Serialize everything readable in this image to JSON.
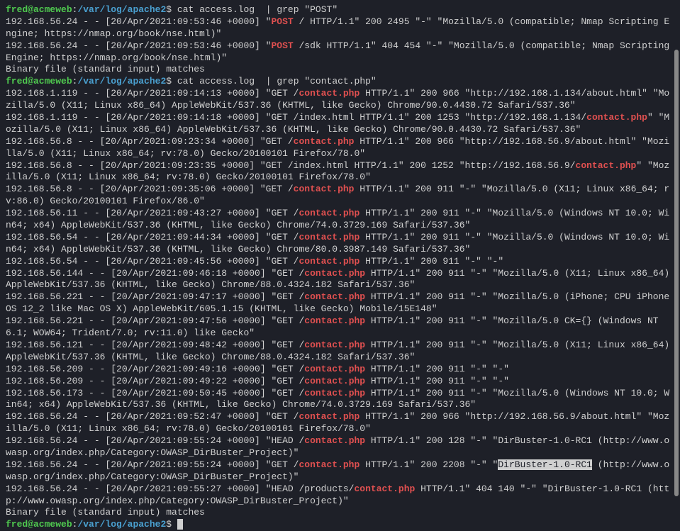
{
  "prompt": {
    "user": "fred@acmeweb",
    "colon": ":",
    "path": "/var/log/apache2",
    "dollar": "$"
  },
  "cmd1": "cat access.log  | grep \"POST\"",
  "cmd2": "cat access.log  | grep \"contact.php\"",
  "lines": {
    "l1a": "192.168.56.24 - - [20/Apr/2021:09:53:46 +0000] \"",
    "l1b": " / HTTP/1.1\" 200 2495 \"-\" \"Mozilla/5.0 (compatible; Nmap Scripting Engine; https://nmap.org/book/nse.html)\"",
    "l2a": "192.168.56.24 - - [20/Apr/2021:09:53:46 +0000] \"",
    "l2b": " /sdk HTTP/1.1\" 404 454 \"-\" \"Mozilla/5.0 (compatible; Nmap Scripting Engine; https://nmap.org/book/nse.html)\"",
    "l3": "Binary file (standard input) matches",
    "c1a": "192.168.1.119 - - [20/Apr/2021:09:14:13 +0000] \"GET /",
    "c1b": " HTTP/1.1\" 200 966 \"http://192.168.1.134/about.html\" \"Mozilla/5.0 (X11; Linux x86_64) AppleWebKit/537.36 (KHTML, like Gecko) Chrome/90.0.4430.72 Safari/537.36\"",
    "c2a": "192.168.1.119 - - [20/Apr/2021:09:14:18 +0000] \"GET /index.html HTTP/1.1\" 200 1253 \"http://192.168.1.134/",
    "c2b": "\" \"Mozilla/5.0 (X11; Linux x86_64) AppleWebKit/537.36 (KHTML, like Gecko) Chrome/90.0.4430.72 Safari/537.36\"",
    "c3a": "192.168.56.8 - - [20/Apr/2021:09:23:34 +0000] \"GET /",
    "c3b": " HTTP/1.1\" 200 966 \"http://192.168.56.9/about.html\" \"Mozilla/5.0 (X11; Linux x86_64; rv:78.0) Gecko/20100101 Firefox/78.0\"",
    "c4a": "192.168.56.8 - - [20/Apr/2021:09:23:35 +0000] \"GET /index.html HTTP/1.1\" 200 1252 \"http://192.168.56.9/",
    "c4b": "\" \"Mozilla/5.0 (X11; Linux x86_64; rv:78.0) Gecko/20100101 Firefox/78.0\"",
    "c5a": "192.168.56.8 - - [20/Apr/2021:09:35:06 +0000] \"GET /",
    "c5b": " HTTP/1.1\" 200 911 \"-\" \"Mozilla/5.0 (X11; Linux x86_64; rv:86.0) Gecko/20100101 Firefox/86.0\"",
    "c6a": "192.168.56.11 - - [20/Apr/2021:09:43:27 +0000] \"GET /",
    "c6b": " HTTP/1.1\" 200 911 \"-\" \"Mozilla/5.0 (Windows NT 10.0; Win64; x64) AppleWebKit/537.36 (KHTML, like Gecko) Chrome/74.0.3729.169 Safari/537.36\"",
    "c7a": "192.168.56.54 - - [20/Apr/2021:09:44:34 +0000] \"GET /",
    "c7b": " HTTP/1.1\" 200 911 \"-\" \"Mozilla/5.0 (Windows NT 10.0; Win64; x64) AppleWebKit/537.36 (KHTML, like Gecko) Chrome/80.0.3987.149 Safari/537.36\"",
    "c8a": "192.168.56.54 - - [20/Apr/2021:09:45:56 +0000] \"GET /",
    "c8b": " HTTP/1.1\" 200 911 \"-\" \"-\"",
    "c9a": "192.168.56.144 - - [20/Apr/2021:09:46:18 +0000] \"GET /",
    "c9b": " HTTP/1.1\" 200 911 \"-\" \"Mozilla/5.0 (X11; Linux x86_64) AppleWebKit/537.36 (KHTML, like Gecko) Chrome/88.0.4324.182 Safari/537.36\"",
    "c10a": "192.168.56.221 - - [20/Apr/2021:09:47:17 +0000] \"GET /",
    "c10b": " HTTP/1.1\" 200 911 \"-\" \"Mozilla/5.0 (iPhone; CPU iPhone OS 12_2 like Mac OS X) AppleWebKit/605.1.15 (KHTML, like Gecko) Mobile/15E148\"",
    "c11a": "192.168.56.221 - - [20/Apr/2021:09:47:56 +0000] \"GET /",
    "c11b": " HTTP/1.1\" 200 911 \"-\" \"Mozilla/5.0 CK={} (Windows NT 6.1; WOW64; Trident/7.0; rv:11.0) like Gecko\"",
    "c12a": "192.168.56.121 - - [20/Apr/2021:09:48:42 +0000] \"GET /",
    "c12b": " HTTP/1.1\" 200 911 \"-\" \"Mozilla/5.0 (X11; Linux x86_64) AppleWebKit/537.36 (KHTML, like Gecko) Chrome/88.0.4324.182 Safari/537.36\"",
    "c13a": "192.168.56.209 - - [20/Apr/2021:09:49:16 +0000] \"GET /",
    "c13b": " HTTP/1.1\" 200 911 \"-\" \"-\"",
    "c14a": "192.168.56.209 - - [20/Apr/2021:09:49:22 +0000] \"GET /",
    "c14b": " HTTP/1.1\" 200 911 \"-\" \"-\"",
    "c15a": "192.168.56.173 - - [20/Apr/2021:09:50:45 +0000] \"GET /",
    "c15b": " HTTP/1.1\" 200 911 \"-\" \"Mozilla/5.0 (Windows NT 10.0; Win64; x64) AppleWebKit/537.36 (KHTML, like Gecko) Chrome/74.0.3729.169 Safari/537.36\"",
    "c16a": "192.168.56.24 - - [20/Apr/2021:09:52:47 +0000] \"GET /",
    "c16b": " HTTP/1.1\" 200 966 \"http://192.168.56.9/about.html\" \"Mozilla/5.0 (X11; Linux x86_64; rv:78.0) Gecko/20100101 Firefox/78.0\"",
    "c17a": "192.168.56.24 - - [20/Apr/2021:09:55:24 +0000] \"HEAD /",
    "c17b": " HTTP/1.1\" 200 128 \"-\" \"DirBuster-1.0-RC1 (http://www.owasp.org/index.php/Category:OWASP_DirBuster_Project)\"",
    "c18a": "192.168.56.24 - - [20/Apr/2021:09:55:24 +0000] \"GET /",
    "c18b": " HTTP/1.1\" 200 2208 \"-\" \"",
    "c18sel": "DirBuster-1.0-RC1",
    "c18c": " (http://www.owasp.org/index.php/Category:OWASP_DirBuster_Project)\"",
    "c19a": "192.168.56.24 - - [20/Apr/2021:09:55:27 +0000] \"HEAD /products/",
    "c19b": " HTTP/1.1\" 404 140 \"-\" \"DirBuster-1.0-RC1 (http://www.owasp.org/index.php/Category:OWASP_DirBuster_Project)\"",
    "c20": "Binary file (standard input) matches",
    "hl_post": "POST",
    "hl_contact": "contact.php"
  }
}
